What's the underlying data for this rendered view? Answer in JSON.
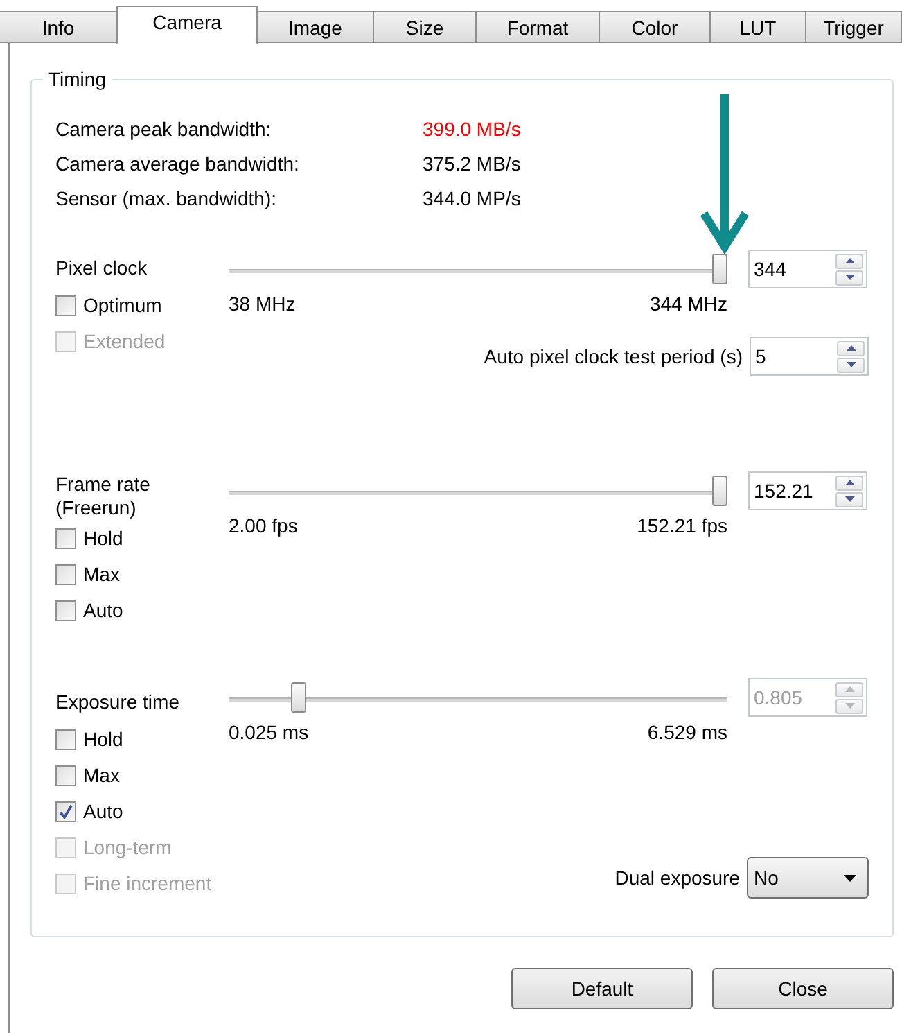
{
  "tabs": [
    {
      "label": "Info",
      "selected": false
    },
    {
      "label": "Camera",
      "selected": true
    },
    {
      "label": "Image",
      "selected": false
    },
    {
      "label": "Size",
      "selected": false
    },
    {
      "label": "Format",
      "selected": false
    },
    {
      "label": "Color",
      "selected": false
    },
    {
      "label": "LUT",
      "selected": false
    },
    {
      "label": "Trigger",
      "selected": false
    }
  ],
  "group": {
    "title": "Timing",
    "stats": [
      {
        "label": "Camera peak bandwidth:",
        "value": "399.0 MB/s",
        "color": "#ff0000"
      },
      {
        "label": "Camera average bandwidth:",
        "value": "375.2 MB/s",
        "color": "#000000"
      },
      {
        "label": "Sensor (max. bandwidth):",
        "value": "344.0 MP/s",
        "color": "#000000"
      }
    ],
    "sections": [
      {
        "label": "Pixel clock",
        "slider": {
          "level": 1,
          "min_label": "38 MHz",
          "max_label": "344 MHz"
        },
        "spin": {
          "value": "344",
          "disabled": false
        },
        "checkboxes": [
          {
            "label": "Optimum",
            "checked": false,
            "disabled": false
          },
          {
            "label": "Extended",
            "checked": false,
            "disabled": true
          }
        ],
        "extra": {
          "label": "Auto pixel clock test period (s)",
          "value": "5"
        }
      },
      {
        "label": "Frame rate (Freerun)",
        "slider": {
          "level": 1,
          "min_label": "2.00 fps",
          "max_label": "152.21 fps"
        },
        "spin": {
          "value": "152.21",
          "disabled": false
        },
        "checkboxes": [
          {
            "label": "Hold",
            "checked": false,
            "disabled": false
          },
          {
            "label": "Max",
            "checked": false,
            "disabled": false
          },
          {
            "label": "Auto",
            "checked": false,
            "disabled": false
          }
        ]
      },
      {
        "label": "Exposure time",
        "slider": {
          "level": 0.13,
          "min_label": "0.025 ms",
          "max_label": "6.529 ms"
        },
        "spin": {
          "value": "0.805",
          "disabled": true
        },
        "checkboxes": [
          {
            "label": "Hold",
            "checked": false,
            "disabled": false
          },
          {
            "label": "Max",
            "checked": false,
            "disabled": false
          },
          {
            "label": "Auto",
            "checked": true,
            "disabled": false
          },
          {
            "label": "Long-term",
            "checked": false,
            "disabled": true
          },
          {
            "label": "Fine increment",
            "checked": false,
            "disabled": true
          }
        ],
        "dropdown": {
          "label": "Dual exposure",
          "value": "No"
        }
      }
    ]
  },
  "buttons": [
    "Default",
    "Close"
  ]
}
